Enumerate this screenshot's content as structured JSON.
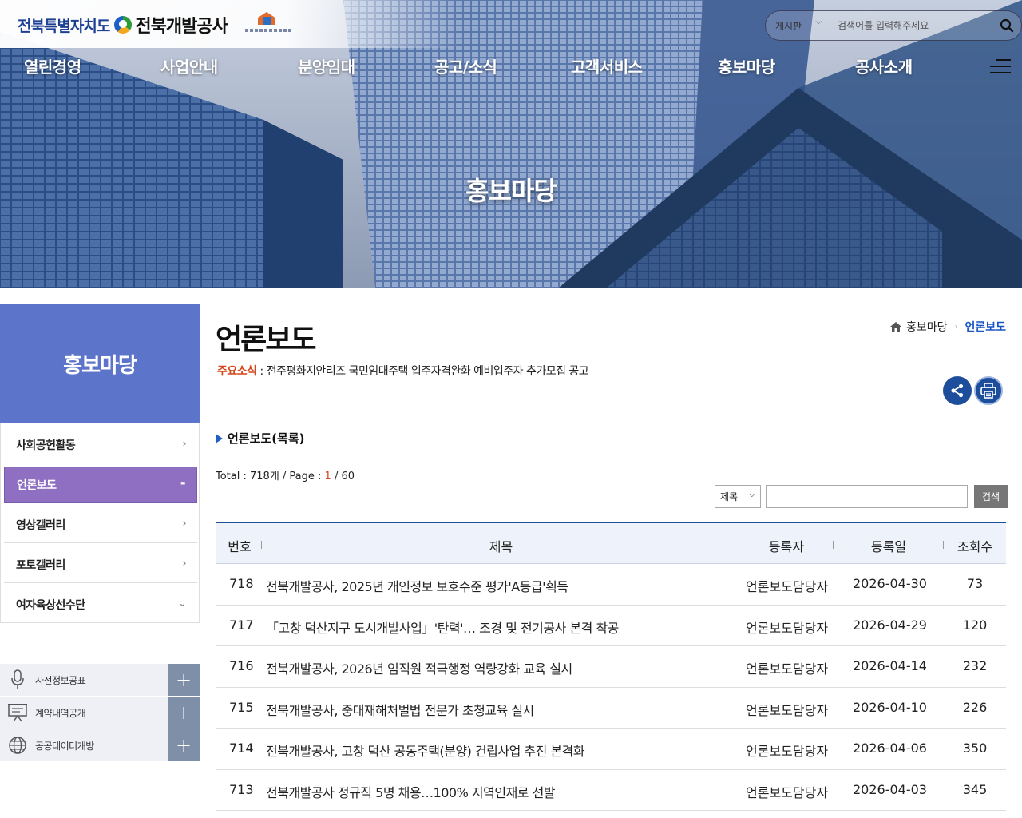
{
  "header": {
    "logo_region": "전북특별자치도",
    "logo_corp": "전북개발공사",
    "search_scope": "게시판",
    "search_placeholder": "검색어를 입력해주세요"
  },
  "gnb": [
    "열린경영",
    "사업안내",
    "분양임대",
    "공고/소식",
    "고객서비스",
    "홍보마당",
    "공사소개"
  ],
  "hero": {
    "title": "홍보마당"
  },
  "sidebar": {
    "title": "홍보마당",
    "items": [
      {
        "label": "사회공헌활동",
        "marker": "›"
      },
      {
        "label": "언론보도",
        "marker": "-"
      },
      {
        "label": "영상갤러리",
        "marker": "›"
      },
      {
        "label": "포토갤러리",
        "marker": "›"
      },
      {
        "label": "여자육상선수단",
        "marker": "⌄"
      }
    ],
    "quick_links": [
      {
        "label": "사전정보공표",
        "icon": "microphone-icon"
      },
      {
        "label": "계약내역공개",
        "icon": "presentation-board-icon"
      },
      {
        "label": "공공데이터개방",
        "icon": "globe-icon"
      }
    ]
  },
  "content": {
    "page_title": "언론보도",
    "breadcrumb": {
      "parent": "홍보마당",
      "current": "언론보도"
    },
    "notice_label": "주요소식",
    "notice_text": " : 전주평화지안리즈 국민임대주택 입주자격완화 예비입주자 추가모집 공고",
    "section_title": "언론보도(목록)",
    "total_prefix": "Total : 718개 / Page : ",
    "page_current": "1",
    "page_suffix": " / 60",
    "search": {
      "field": "제목",
      "button": "검색"
    },
    "table": {
      "headers": [
        "번호",
        "제목",
        "등록자",
        "등록일",
        "조회수"
      ],
      "rows": [
        {
          "no": "718",
          "title": "전북개발공사, 2025년 개인정보 보호수준 평가'A등급'획득",
          "writer": "언론보도담당자",
          "date": "2026-04-30",
          "views": "73"
        },
        {
          "no": "717",
          "title": "「고창 덕산지구 도시개발사업」'탄력'… 조경 및 전기공사 본격 착공",
          "writer": "언론보도담당자",
          "date": "2026-04-29",
          "views": "120"
        },
        {
          "no": "716",
          "title": "전북개발공사, 2026년 임직원 적극행정 역량강화 교육 실시",
          "writer": "언론보도담당자",
          "date": "2026-04-14",
          "views": "232"
        },
        {
          "no": "715",
          "title": "전북개발공사, 중대재해처벌법 전문가 초청교육 실시",
          "writer": "언론보도담당자",
          "date": "2026-04-10",
          "views": "226"
        },
        {
          "no": "714",
          "title": "전북개발공사, 고창 덕산 공동주택(분양) 건립사업 추진 본격화",
          "writer": "언론보도담당자",
          "date": "2026-04-06",
          "views": "350"
        },
        {
          "no": "713",
          "title": "전북개발공사 정규직 5명 채용…100% 지역인재로 선발",
          "writer": "언론보도담당자",
          "date": "2026-04-03",
          "views": "345"
        }
      ]
    }
  }
}
